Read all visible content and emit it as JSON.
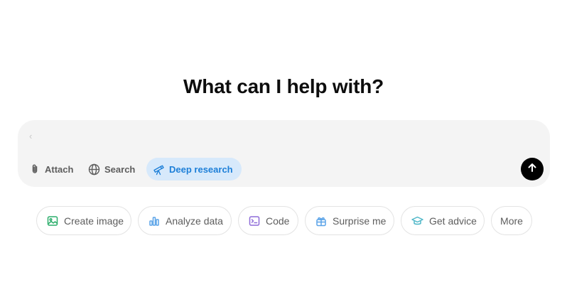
{
  "headline": "What can I help with?",
  "composer": {
    "value": "",
    "caret_glyph": "‹",
    "tools": {
      "attach_label": "Attach",
      "search_label": "Search",
      "deep_research_label": "Deep research"
    },
    "send_icon": "arrow-up-icon"
  },
  "suggestions": [
    {
      "label": "Create image",
      "icon": "image-icon",
      "color": "#2cae6b"
    },
    {
      "label": "Analyze data",
      "icon": "bar-chart-icon",
      "color": "#5aa3e8"
    },
    {
      "label": "Code",
      "icon": "terminal-icon",
      "color": "#8e6bd8"
    },
    {
      "label": "Surprise me",
      "icon": "gift-icon",
      "color": "#5aa3e8"
    },
    {
      "label": "Get advice",
      "icon": "graduation-cap-icon",
      "color": "#4fb7c8"
    },
    {
      "label": "More",
      "icon": "",
      "color": ""
    }
  ],
  "colors": {
    "composer_bg": "#f4f4f4",
    "deep_research_bg": "#d7e9fb",
    "deep_research_text": "#1d7fd8",
    "send_button": "#000000"
  }
}
